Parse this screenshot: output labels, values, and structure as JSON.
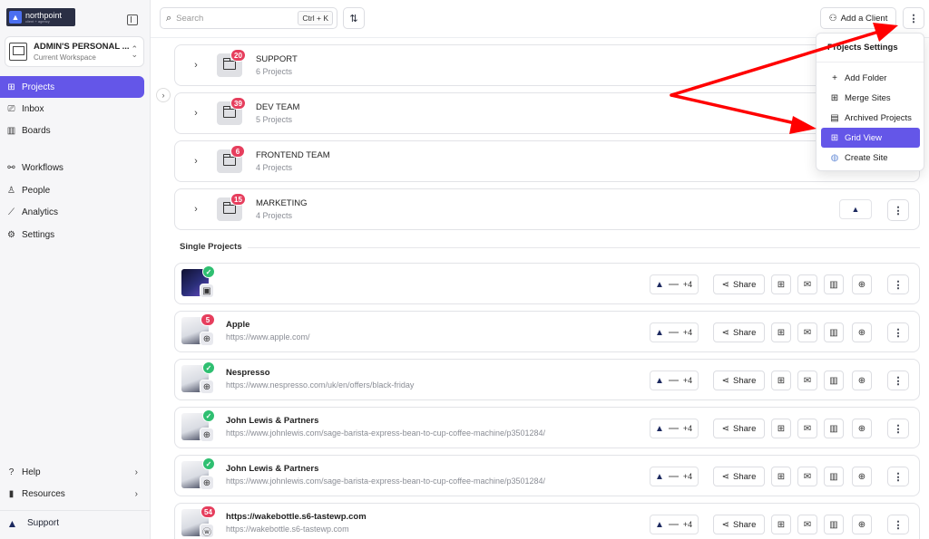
{
  "brand": {
    "name": "northpoint",
    "tagline": "client + agency"
  },
  "workspace": {
    "title": "ADMIN'S PERSONAL ...",
    "subtitle": "Current Workspace"
  },
  "sidebar": {
    "items": [
      {
        "label": "Projects",
        "icon": "grid-icon"
      },
      {
        "label": "Inbox",
        "icon": "inbox-icon"
      },
      {
        "label": "Boards",
        "icon": "board-icon"
      },
      {
        "label": "Workflows",
        "icon": "workflow-icon"
      },
      {
        "label": "People",
        "icon": "person-icon"
      },
      {
        "label": "Analytics",
        "icon": "analytics-icon"
      },
      {
        "label": "Settings",
        "icon": "gear-icon"
      }
    ],
    "bottom": [
      {
        "label": "Help",
        "icon": "help-icon"
      },
      {
        "label": "Resources",
        "icon": "resources-icon"
      }
    ],
    "support": "Support"
  },
  "search": {
    "placeholder": "Search",
    "shortcut": "Ctrl + K"
  },
  "toolbar": {
    "add_client": "Add a Client"
  },
  "folders": [
    {
      "name": "SUPPORT",
      "count": "6 Projects",
      "badge": "20"
    },
    {
      "name": "DEV TEAM",
      "count": "5 Projects",
      "badge": "39"
    },
    {
      "name": "FRONTEND TEAM",
      "count": "4 Projects",
      "badge": "6"
    },
    {
      "name": "MARKETING",
      "count": "4 Projects",
      "badge": "15"
    }
  ],
  "single_projects_label": "Single Projects",
  "projects": [
    {
      "name": "",
      "url": "",
      "status": "check",
      "extra": "+4"
    },
    {
      "name": "Apple",
      "url": "https://www.apple.com/",
      "status": "5",
      "extra": "+4"
    },
    {
      "name": "Nespresso",
      "url": "https://www.nespresso.com/uk/en/offers/black-friday",
      "status": "check",
      "extra": "+4"
    },
    {
      "name": "John Lewis & Partners",
      "url": "https://www.johnlewis.com/sage-barista-express-bean-to-cup-coffee-machine/p3501284/",
      "status": "check",
      "extra": "+4"
    },
    {
      "name": "John Lewis & Partners",
      "url": "https://www.johnlewis.com/sage-barista-express-bean-to-cup-coffee-machine/p3501284/",
      "status": "check",
      "extra": "+4"
    },
    {
      "name": "https://wakebottle.s6-tastewp.com",
      "url": "https://wakebottle.s6-tastewp.com",
      "status": "54",
      "extra": "+4"
    }
  ],
  "share_label": "Share",
  "dropdown": {
    "title": "Projects Settings",
    "items": [
      {
        "label": "Add Folder",
        "icon": "plus-icon"
      },
      {
        "label": "Merge Sites",
        "icon": "merge-icon"
      },
      {
        "label": "Archived Projects",
        "icon": "archive-icon"
      },
      {
        "label": "Grid View",
        "icon": "grid-icon"
      },
      {
        "label": "Create Site",
        "icon": "create-site-icon"
      }
    ]
  },
  "colors": {
    "accent": "#6456e8",
    "badge": "#e63e5d",
    "success": "#2fbf71",
    "annotation": "#ff0000"
  }
}
